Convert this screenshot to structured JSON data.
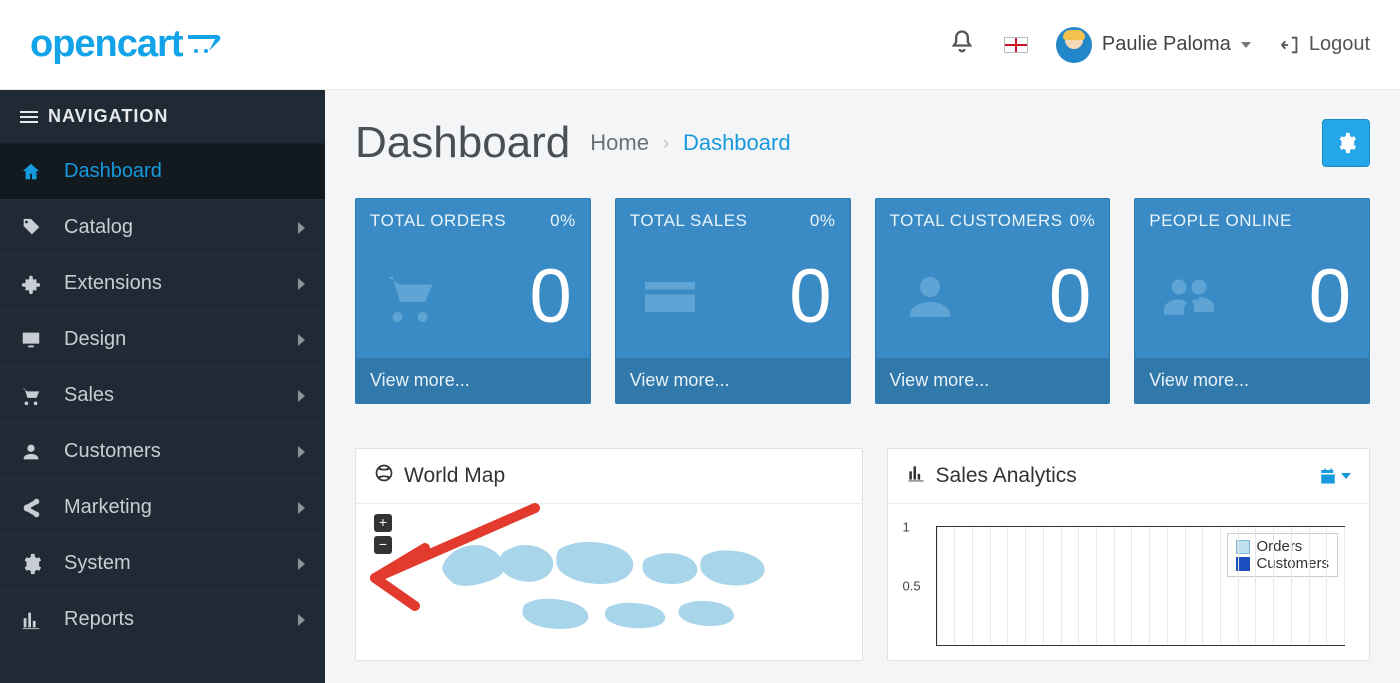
{
  "brand": "opencart",
  "header": {
    "user_name": "Paulie Paloma",
    "logout_label": "Logout",
    "flag": "en-gb"
  },
  "sidebar": {
    "title": "NAVIGATION",
    "items": [
      {
        "label": "Dashboard",
        "icon": "home",
        "active": true,
        "has_children": false
      },
      {
        "label": "Catalog",
        "icon": "tag",
        "active": false,
        "has_children": true
      },
      {
        "label": "Extensions",
        "icon": "puzzle",
        "active": false,
        "has_children": true
      },
      {
        "label": "Design",
        "icon": "monitor",
        "active": false,
        "has_children": true
      },
      {
        "label": "Sales",
        "icon": "cart",
        "active": false,
        "has_children": true
      },
      {
        "label": "Customers",
        "icon": "user",
        "active": false,
        "has_children": true
      },
      {
        "label": "Marketing",
        "icon": "share",
        "active": false,
        "has_children": true
      },
      {
        "label": "System",
        "icon": "gear",
        "active": false,
        "has_children": true
      },
      {
        "label": "Reports",
        "icon": "bars",
        "active": false,
        "has_children": true
      }
    ]
  },
  "page": {
    "title": "Dashboard",
    "breadcrumb_home": "Home",
    "breadcrumb_current": "Dashboard"
  },
  "tiles": [
    {
      "title": "TOTAL ORDERS",
      "percent": "0%",
      "value": "0",
      "footer": "View more...",
      "icon": "cart"
    },
    {
      "title": "TOTAL SALES",
      "percent": "0%",
      "value": "0",
      "footer": "View more...",
      "icon": "card"
    },
    {
      "title": "TOTAL CUSTOMERS",
      "percent": "0%",
      "value": "0",
      "footer": "View more...",
      "icon": "user"
    },
    {
      "title": "PEOPLE ONLINE",
      "percent": "",
      "value": "0",
      "footer": "View more...",
      "icon": "people"
    }
  ],
  "panels": {
    "map_title": "World Map",
    "map_zoom_in": "+",
    "map_zoom_out": "−",
    "analytics_title": "Sales Analytics",
    "legend_orders": "Orders",
    "legend_customers": "Customers"
  },
  "chart_data": {
    "type": "line",
    "title": "Sales Analytics",
    "xlabel": "",
    "ylabel": "",
    "ylim": [
      0,
      1
    ],
    "x": [
      0,
      1,
      2,
      3,
      4,
      5,
      6,
      7,
      8,
      9,
      10,
      11,
      12,
      13,
      14,
      15,
      16,
      17,
      18,
      19,
      20,
      21,
      22,
      23
    ],
    "series": [
      {
        "name": "Orders",
        "values": [
          0,
          0,
          0,
          0,
          0,
          0,
          0,
          0,
          0,
          0,
          0,
          0,
          0,
          0,
          0,
          0,
          0,
          0,
          0,
          0,
          0,
          0,
          0,
          0
        ]
      },
      {
        "name": "Customers",
        "values": [
          0,
          0,
          0,
          0,
          0,
          0,
          0,
          0,
          0,
          0,
          0,
          0,
          0,
          0,
          0,
          0,
          0,
          0,
          0,
          0,
          0,
          0,
          0,
          0
        ]
      }
    ],
    "yticks": [
      0.5,
      1.0
    ]
  }
}
